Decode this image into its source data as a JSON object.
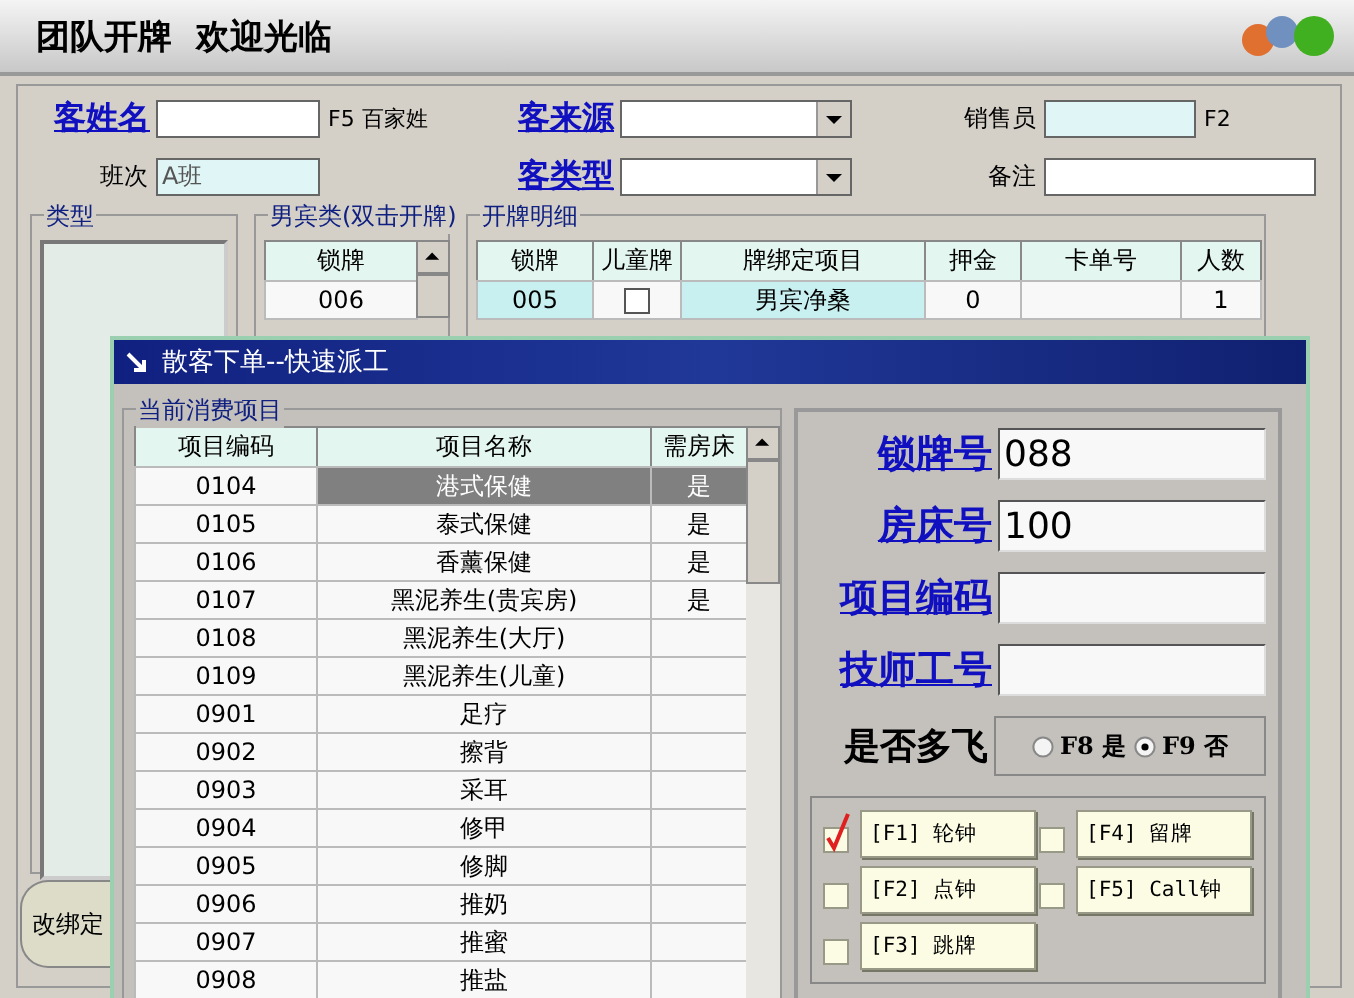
{
  "window": {
    "title": "团队开牌  欢迎光临"
  },
  "form": {
    "guest_name": {
      "label": "客姓名",
      "hint": "F5 百家姓"
    },
    "shift": {
      "label": "班次",
      "value": "A班"
    },
    "source": {
      "label": "客来源"
    },
    "guest_type": {
      "label": "客类型"
    },
    "salesperson": {
      "label": "销售员",
      "hint": "F2"
    },
    "remark": {
      "label": "备注"
    }
  },
  "type_group": {
    "title": "类型"
  },
  "male_group": {
    "title": "男宾类(双击开牌)",
    "column": "锁牌",
    "rows": [
      "006"
    ]
  },
  "detail_group": {
    "title": "开牌明细",
    "columns": [
      "锁牌",
      "儿童牌",
      "牌绑定项目",
      "押金",
      "卡单号",
      "人数"
    ],
    "rows": [
      {
        "lock": "005",
        "child": false,
        "item": "男宾净桑",
        "deposit": "0",
        "people": "1"
      }
    ]
  },
  "bottom_button": "改绑定",
  "dialog": {
    "title": "散客下单--快速派工",
    "items_group": {
      "title": "当前消费项目",
      "columns": [
        "项目编码",
        "项目名称",
        "需房床"
      ],
      "rows": [
        {
          "code": "0104",
          "name": "港式保健",
          "needs_bed": "是",
          "selected": true
        },
        {
          "code": "0105",
          "name": "泰式保健",
          "needs_bed": "是",
          "selected": false
        },
        {
          "code": "0106",
          "name": "香薰保健",
          "needs_bed": "是",
          "selected": false
        },
        {
          "code": "0107",
          "name": "黑泥养生(贵宾房)",
          "needs_bed": "是",
          "selected": false
        },
        {
          "code": "0108",
          "name": "黑泥养生(大厅)",
          "selected": false
        },
        {
          "code": "0109",
          "name": "黑泥养生(儿童)",
          "selected": false
        },
        {
          "code": "0901",
          "name": "足疗",
          "selected": false
        },
        {
          "code": "0902",
          "name": "擦背",
          "selected": false
        },
        {
          "code": "0903",
          "name": "采耳",
          "selected": false
        },
        {
          "code": "0904",
          "name": "修甲",
          "selected": false
        },
        {
          "code": "0905",
          "name": "修脚",
          "selected": false
        },
        {
          "code": "0906",
          "name": "推奶",
          "selected": false
        },
        {
          "code": "0907",
          "name": "推蜜",
          "selected": false
        },
        {
          "code": "0908",
          "name": "推盐",
          "selected": false
        }
      ]
    },
    "fields": [
      {
        "label": "锁牌号",
        "value": "088"
      },
      {
        "label": "房床号",
        "value": "100"
      },
      {
        "label": "项目编码"
      },
      {
        "label": "技师工号"
      }
    ],
    "multi": {
      "label": "是否多飞",
      "options": [
        {
          "label": "F8 是",
          "selected": false
        },
        {
          "label": "F9 否",
          "selected": true
        }
      ]
    },
    "options": [
      {
        "label": "[F1] 轮钟",
        "checked": true
      },
      {
        "label": "[F4] 留牌",
        "checked": false
      },
      {
        "label": "[F2] 点钟",
        "checked": false
      },
      {
        "label": "[F5] Call钟",
        "checked": false
      },
      {
        "label": "[F3] 跳牌",
        "checked": false
      }
    ]
  }
}
